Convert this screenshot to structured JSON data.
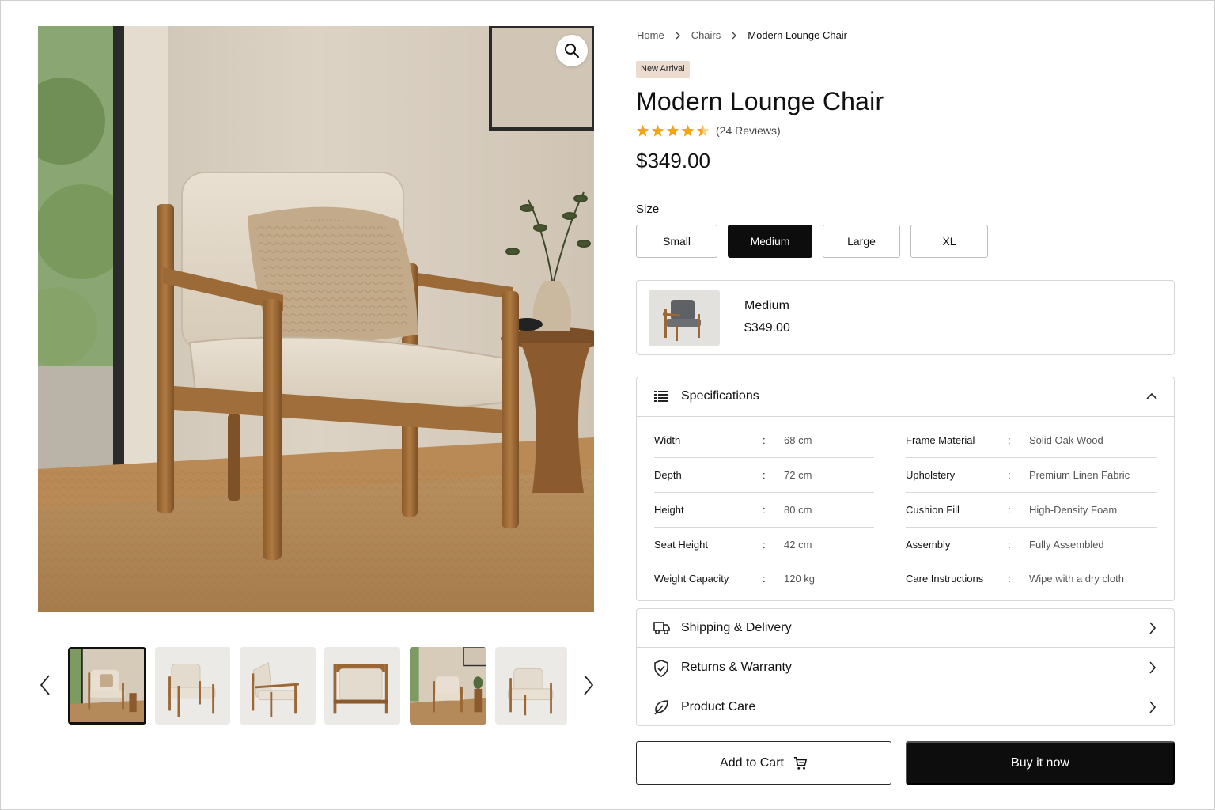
{
  "breadcrumb": {
    "home": "Home",
    "category": "Chairs",
    "current": "Modern Lounge Chair"
  },
  "product": {
    "badge": "New Arrival",
    "title": "Modern Lounge Chair",
    "rating": 4.5,
    "reviews": "(24 Reviews)",
    "price": "$349.00"
  },
  "size": {
    "label": "Size",
    "options": [
      "Small",
      "Medium",
      "Large",
      "XL"
    ],
    "selected": "Medium"
  },
  "variant": {
    "name": "Medium",
    "price": "$349.00"
  },
  "specifications": {
    "title": "Specifications",
    "left": [
      {
        "key": "Width",
        "value": "68 cm"
      },
      {
        "key": "Depth",
        "value": "72 cm"
      },
      {
        "key": "Height",
        "value": "80 cm"
      },
      {
        "key": "Seat Height",
        "value": "42 cm"
      },
      {
        "key": "Weight Capacity",
        "value": "120 kg"
      }
    ],
    "right": [
      {
        "key": "Frame Material",
        "value": "Solid Oak Wood"
      },
      {
        "key": "Upholstery",
        "value": "Premium Linen Fabric"
      },
      {
        "key": "Cushion Fill",
        "value": "High-Density Foam"
      },
      {
        "key": "Assembly",
        "value": "Fully Assembled"
      },
      {
        "key": "Care Instructions",
        "value": "Wipe with a dry cloth"
      }
    ],
    "separator": ":"
  },
  "accordion": {
    "shipping": "Shipping & Delivery",
    "returns": "Returns & Warranty",
    "care": "Product Care"
  },
  "actions": {
    "add_to_cart": "Add to Cart",
    "buy_now": "Buy it now"
  },
  "icons": {
    "zoom": "search-icon",
    "prev": "chevron-left-icon",
    "next": "chevron-right-icon",
    "specs": "list-icon",
    "shipping": "truck-icon",
    "returns": "shield-check-icon",
    "care": "leaf-icon",
    "cart": "cart-icon"
  },
  "colors": {
    "star": "#f2a516",
    "badge_bg": "#ecdcd0",
    "primary": "#0d0d0d"
  }
}
